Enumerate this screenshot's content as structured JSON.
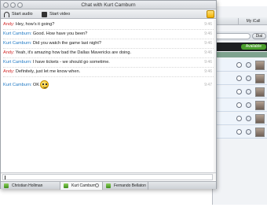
{
  "window": {
    "title": "Chat with Kurt Camburn"
  },
  "toolbar": {
    "start_audio": "Start audio",
    "start_video": "Start video"
  },
  "messages": [
    {
      "sender": "Andy:",
      "kind": "a",
      "text": " Hey, how's it going?",
      "time": "9:46"
    },
    {
      "sender": "Kurt Camburn:",
      "kind": "k",
      "text": " Good. How have you been?",
      "time": "9:46"
    },
    {
      "sender": "Kurt Camburn:",
      "kind": "k",
      "text": " Did you watch the game last night?",
      "time": "9:46"
    },
    {
      "sender": "Andy:",
      "kind": "a",
      "text": " Yeah, it's amazing how bad the Dallas Mavericks are doing.",
      "time": "9:46"
    },
    {
      "sender": "Kurt Camburn:",
      "kind": "k",
      "text": " I have tickets - we should go sometime.",
      "time": "9:46"
    },
    {
      "sender": "Andy:",
      "kind": "a",
      "text": " Definitely, just let me know when.",
      "time": "9:46"
    },
    {
      "sender": "Kurt Camburn:",
      "kind": "k",
      "text": " OK",
      "time": "9:47"
    }
  ],
  "tabs": [
    {
      "label": "Christian Hollman"
    },
    {
      "label": "Kurt Camburn"
    },
    {
      "label": "Fernando Bellaton"
    }
  ],
  "contacts_window": {
    "tab_my_ical": "My iCall",
    "dial_button": "Dial",
    "status": "Available"
  },
  "colors": {
    "andy": "#d12727",
    "kurt": "#1f79c4",
    "available": "#4a9e2c"
  },
  "icons": [
    "audio-icon",
    "video-icon",
    "emoji-icon",
    "smiley-icon",
    "status-icon",
    "close-icon"
  ]
}
